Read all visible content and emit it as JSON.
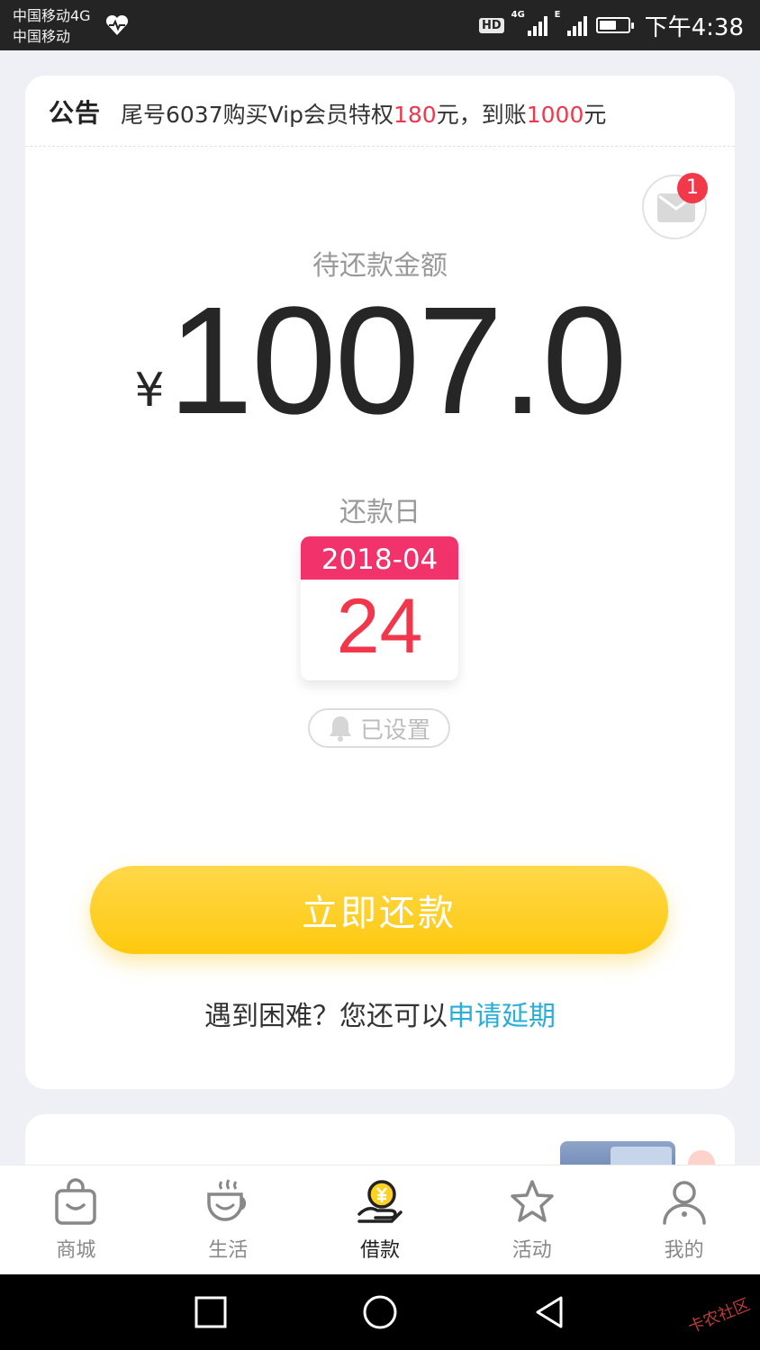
{
  "status_bar": {
    "carrier_line1": "中国移动4G",
    "carrier_line2": "中国移动",
    "hd": "HD",
    "net1": "4G",
    "net2": "E",
    "time": "下午4:38",
    "battery_fraction": 0.6
  },
  "notice": {
    "tag": "公告",
    "text_prefix": "尾号6037购买Vip会员特权",
    "amount_paid": "180",
    "text_mid": "元，到账",
    "amount_received": "1000",
    "text_suffix": "元"
  },
  "mail": {
    "badge_count": "1"
  },
  "repayment": {
    "amount_label": "待还款金额",
    "currency": "¥",
    "amount": "1007.0",
    "due_label": "还款日",
    "due_month": "2018-04",
    "due_day": "24",
    "reminder_label": "已设置"
  },
  "actions": {
    "repay_button": "立即还款",
    "help_prefix": "遇到困难？您还可以",
    "help_link": "申请延期"
  },
  "tabs": [
    {
      "label": "商城",
      "icon": "shop-bag-icon"
    },
    {
      "label": "生活",
      "icon": "coffee-cup-icon"
    },
    {
      "label": "借款",
      "icon": "loan-coin-hand-icon",
      "active": true
    },
    {
      "label": "活动",
      "icon": "star-icon"
    },
    {
      "label": "我的",
      "icon": "person-icon"
    }
  ],
  "watermark": "卡农社区",
  "colors": {
    "accent_red": "#f0384d",
    "calendar_pink": "#f2336b",
    "button_yellow": "#fec90e",
    "link_blue": "#2aaed9"
  }
}
